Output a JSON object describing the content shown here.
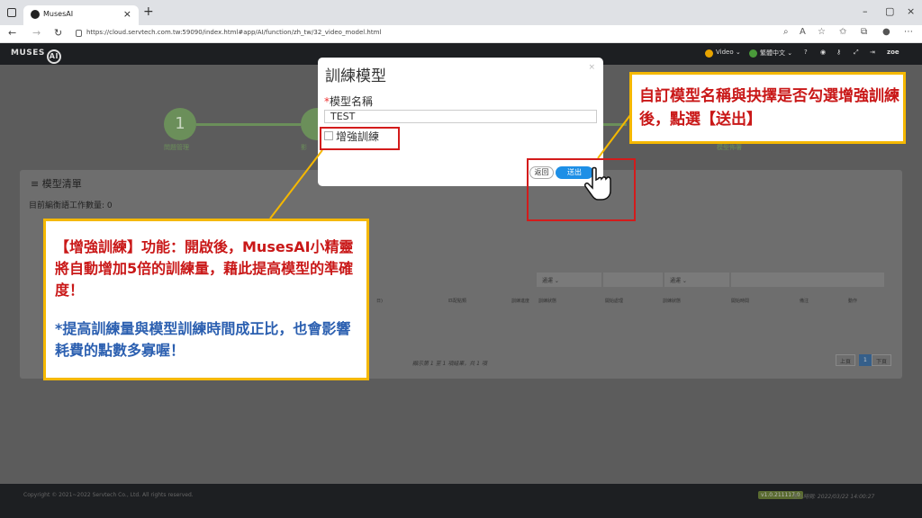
{
  "browser": {
    "tab_title": "MusesAI",
    "url": "https://cloud.servtech.com.tw:59090/index.html#app/AI/function/zh_tw/32_video_model.html"
  },
  "header": {
    "logo": "MUSES",
    "logo_ai": "AI",
    "video_menu": "Video",
    "lang_menu": "繁體中文",
    "user": "zoe"
  },
  "stepper": {
    "step1_number": "1",
    "step1_label": "問題管理",
    "step2_label": "影",
    "step_last_label": "模型佈署"
  },
  "panel": {
    "title": "模型清單",
    "task_count": "目前編衡語工作數量: 0",
    "filter1": "通運",
    "filter2": "通運",
    "columns": [
      "日)",
      "匹配點類",
      "訓練進度",
      "訓練狀態",
      "開始處理",
      "訓練狀態",
      "開始時間",
      "備注",
      "動作"
    ],
    "footer_text": "顯示第 1 至 1 項結果，共 1 項",
    "page_prev": "上頁",
    "page_current": "1",
    "page_next": "下頁"
  },
  "footer": {
    "copyright": "Copyright © 2021~2022 Servtech Co., Ltd. All rights reserved.",
    "version": "v1.0.211117.0",
    "login_info": "登入時間: 2022/03/22 14:00:27"
  },
  "modal": {
    "title": "訓練模型",
    "close": "×",
    "required_mark": "*",
    "name_label": "模型名稱",
    "name_value": "TEST",
    "checkbox_label": "增強訓練",
    "checkbox_checked": false,
    "back_button": "返回",
    "submit_button": "送出"
  },
  "annotations": {
    "callout_top": "自訂模型名稱與抉擇是否勾選增強訓練後，點選【送出】",
    "callout_left_1": "【增強訓練】功能：開啟後，MusesAI小精靈將自動增加5倍的訓練量，藉此提高模型的準確度！",
    "callout_left_2": "*提高訓練量與模型訓練時間成正比，也會影響耗費的點數多寡喔！"
  },
  "colors": {
    "accent_blue": "#1e8fe6",
    "annotation_red": "#d31b1b",
    "annotation_yellow": "#f5b800",
    "step_green": "#6b8f5a"
  }
}
